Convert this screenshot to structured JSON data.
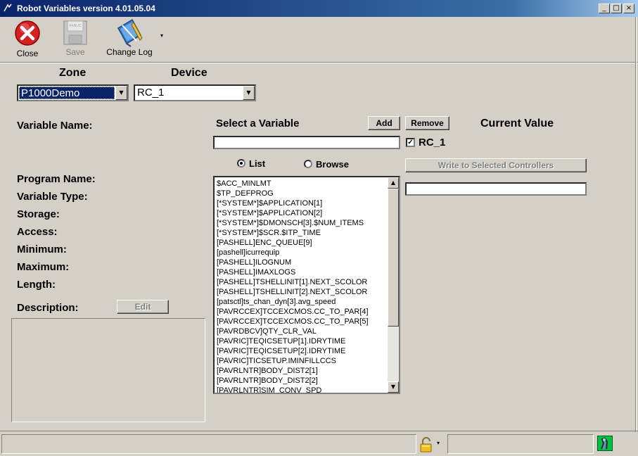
{
  "window": {
    "title": "Robot Variables  version  4.01.05.04"
  },
  "toolbar": {
    "close_label": "Close",
    "save_label": "Save",
    "changelog_label": "Change Log",
    "save_icon_text": "FANUC"
  },
  "zone": {
    "label": "Zone",
    "value": "P1000Demo"
  },
  "device": {
    "label": "Device",
    "value": "RC_1"
  },
  "labels": {
    "variable_name": "Variable Name:",
    "select_variable": "Select a Variable",
    "current_value": "Current Value",
    "program_name": "Program Name:",
    "variable_type": "Variable Type:",
    "storage": "Storage:",
    "access": "Access:",
    "minimum": "Minimum:",
    "maximum": "Maximum:",
    "length": "Length:",
    "description": "Description:"
  },
  "buttons": {
    "add": "Add",
    "remove": "Remove",
    "write": "Write to Selected Controllers",
    "edit": "Edit"
  },
  "controller_check": {
    "label": "RC_1",
    "checked": true
  },
  "mode": {
    "list_label": "List",
    "browse_label": "Browse",
    "selected": "List"
  },
  "variables": [
    "$ACC_MINLMT",
    "$TP_DEFPROG",
    "[*SYSTEM*]$APPLICATION[1]",
    "[*SYSTEM*]$APPLICATION[2]",
    "[*SYSTEM*]$DMONSCH[3].$NUM_ITEMS",
    "[*SYSTEM*]$SCR.$ITP_TIME",
    "[PASHELL]ENC_QUEUE[9]",
    "[pashell]icurrequip",
    "[PASHELL]ILOGNUM",
    "[PASHELL]IMAXLOGS",
    "[PASHELL]TSHELLINIT[1].NEXT_SCOLOR",
    "[PASHELL]TSHELLINIT[2].NEXT_SCOLOR",
    "[patsctl]ts_chan_dyn[3].avg_speed",
    "[PAVRCCEX]TCCEXCMOS.CC_TO_PAR[4]",
    "[PAVRCCEX]TCCEXCMOS.CC_TO_PAR[5]",
    "[PAVRDBCV]QTY_CLR_VAL",
    "[PAVRIC]TEQICSETUP[1].IDRYTIME",
    "[PAVRIC]TEQICSETUP[2].IDRYTIME",
    "[PAVRIC]TICSETUP.IMINFILLCCS",
    "[PAVRLNTR]BODY_DIST2[1]",
    "[PAVRLNTR]BODY_DIST2[2]",
    "[PAVRLNTR]SIM_CONV_SPD"
  ],
  "icons": {
    "close": "close-x-icon",
    "save": "floppy-disk-icon",
    "changelog": "book-pencil-icon",
    "status_lock": "padlock-icon",
    "status_robot": "robot-icon"
  },
  "colors": {
    "selection": "#0a246a",
    "close_red": "#d42020",
    "robot_green": "#00c040"
  }
}
